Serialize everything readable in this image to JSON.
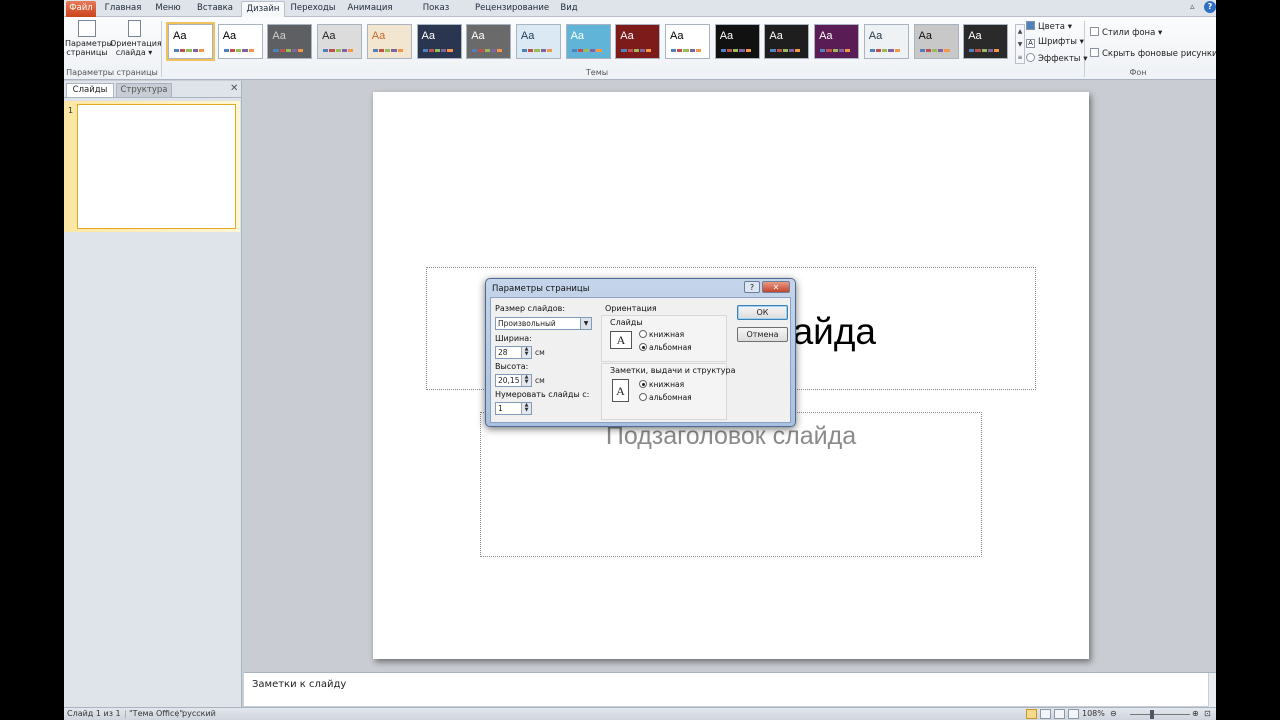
{
  "tabs": {
    "file": "Файл",
    "home": "Главная",
    "menu": "Меню",
    "insert": "Вставка",
    "design": "Дизайн",
    "transitions": "Переходы",
    "animation": "Анимация",
    "slideshow": "Показ слайдов",
    "review": "Рецензирование",
    "view": "Вид"
  },
  "ribbon": {
    "page_setup": {
      "line1": "Параметры",
      "line2": "страницы"
    },
    "orientation": {
      "line1": "Ориентация",
      "line2": "слайда ▾"
    },
    "group_page_setup": "Параметры страницы",
    "group_themes": "Темы",
    "theme_glyph": "Aa",
    "colors": "Цвета ▾",
    "fonts": "Шрифты ▾",
    "effects": "Эффекты ▾",
    "bg_styles": "Стили фона ▾",
    "hide_bg": "Скрыть фоновые рисунки",
    "group_background": "Фон"
  },
  "themes": [
    {
      "bg": "#ffffff",
      "fg": "#000000",
      "selected": true
    },
    {
      "bg": "#ffffff",
      "fg": "#000000"
    },
    {
      "bg": "#5d5f62",
      "fg": "#d0d0d0"
    },
    {
      "bg": "#dcdcdc",
      "fg": "#222222"
    },
    {
      "bg": "#f3e6d0",
      "fg": "#c46a2a"
    },
    {
      "bg": "#2a3550",
      "fg": "#ffffff"
    },
    {
      "bg": "#6a6a6a",
      "fg": "#ffffff"
    },
    {
      "bg": "#dbe9f4",
      "fg": "#1d3b5a"
    },
    {
      "bg": "#5fb4d8",
      "fg": "#ffffff"
    },
    {
      "bg": "#7d1a1a",
      "fg": "#ffffff"
    },
    {
      "bg": "#ffffff",
      "fg": "#000000"
    },
    {
      "bg": "#111111",
      "fg": "#ffffff"
    },
    {
      "bg": "#1e1e1e",
      "fg": "#ffffff"
    },
    {
      "bg": "#5a1c55",
      "fg": "#ffffff"
    },
    {
      "bg": "#eef2f5",
      "fg": "#2a3a4a"
    },
    {
      "bg": "#c8c8c8",
      "fg": "#111111"
    },
    {
      "bg": "#2a2a2a",
      "fg": "#ffffff"
    }
  ],
  "left_pane": {
    "tab_slides": "Слайды",
    "tab_outline": "Структура",
    "close": "✕",
    "slide_number": "1"
  },
  "slide": {
    "title": "лайда",
    "subtitle": "Подзаголовок слайда"
  },
  "notes": {
    "placeholder": "Заметки к слайду"
  },
  "status": {
    "slide_info": "Слайд 1 из 1",
    "theme": "\"Тема Office\"",
    "language": "русский",
    "zoom": "108%"
  },
  "dialog": {
    "title": "Параметры страницы",
    "help": "?",
    "close": "✕",
    "size_label": "Размер слайдов:",
    "size_value": "Произвольный",
    "width_label": "Ширина:",
    "width_value": "28",
    "height_label": "Высота:",
    "height_value": "20,15",
    "unit": "см",
    "numbering_label": "Нумеровать слайды с:",
    "numbering_value": "1",
    "orientation_label": "Ориентация",
    "slides_label": "Слайды",
    "notes_label": "Заметки, выдачи и структура",
    "portrait": "книжная",
    "landscape": "альбомная",
    "slides_orientation": "landscape",
    "notes_orientation": "portrait",
    "ok": "ОК",
    "cancel": "Отмена"
  }
}
